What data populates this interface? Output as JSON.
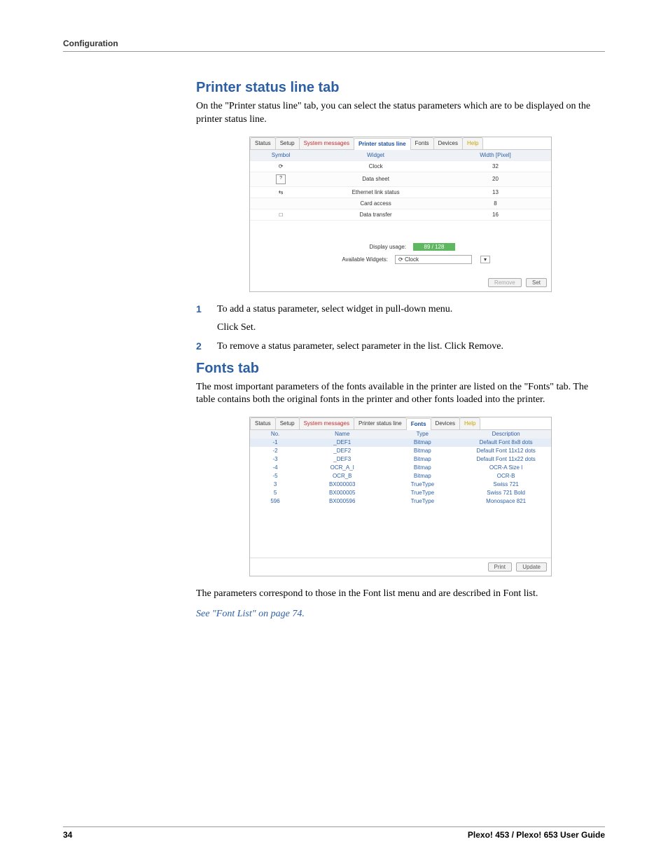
{
  "page": {
    "header": "Configuration",
    "number": "34",
    "guide": "Plexo! 453 / Plexo! 653 User Guide"
  },
  "section1": {
    "title": "Printer status line tab",
    "intro": "On the \"Printer status line\" tab, you can select the status parameters which are to be displayed on the printer status line.",
    "step1_num": "1",
    "step1": "To add a status parameter, select widget in pull-down menu.",
    "step1_sub": "Click Set.",
    "step2_num": "2",
    "step2": "To remove a status parameter, select parameter in the list. Click Remove."
  },
  "section2": {
    "title": "Fonts tab",
    "intro": "The most important parameters of the fonts available in the printer are listed on the \"Fonts\" tab. The table contains both the original fonts in the printer and other fonts loaded into the printer.",
    "after": "The parameters correspond to those in the Font list menu and are described in Font list.",
    "link": "See \"Font List\" on page 74."
  },
  "screenshot_tabs": {
    "status": "Status",
    "setup": "Setup",
    "system_messages": "System messages",
    "printer_status_line": "Printer status line",
    "fonts": "Fonts",
    "devices": "Devices",
    "help": "Help"
  },
  "screenshot1": {
    "hdr": {
      "symbol": "Symbol",
      "widget": "Widget",
      "width": "Width [Pixel]"
    },
    "rows": [
      {
        "symbol": "⟳",
        "widget": "Clock",
        "width": "32"
      },
      {
        "symbol": "?",
        "widget": "Data sheet",
        "width": "20"
      },
      {
        "symbol": "⇆",
        "widget": "Ethernet link status",
        "width": "13"
      },
      {
        "symbol": "",
        "widget": "Card access",
        "width": "8"
      },
      {
        "symbol": "□",
        "widget": "Data transfer",
        "width": "16"
      }
    ],
    "display_usage_label": "Display usage:",
    "display_usage_value": "89 / 128",
    "available_label": "Available Widgets:",
    "available_value": "Clock",
    "remove": "Remove",
    "set": "Set"
  },
  "screenshot2": {
    "hdr": {
      "no": "No.",
      "name": "Name",
      "type": "Type",
      "desc": "Description"
    },
    "rows": [
      {
        "no": "-1",
        "name": "_DEF1",
        "type": "Bitmap",
        "desc": "Default Font 8x8 dots"
      },
      {
        "no": "-2",
        "name": "_DEF2",
        "type": "Bitmap",
        "desc": "Default Font 11x12 dots"
      },
      {
        "no": "-3",
        "name": "_DEF3",
        "type": "Bitmap",
        "desc": "Default Font 11x22 dots"
      },
      {
        "no": "-4",
        "name": "OCR_A_I",
        "type": "Bitmap",
        "desc": "OCR-A Size I"
      },
      {
        "no": "-5",
        "name": "OCR_B",
        "type": "Bitmap",
        "desc": "OCR-B"
      },
      {
        "no": "3",
        "name": "BX000003",
        "type": "TrueType",
        "desc": "Swiss 721"
      },
      {
        "no": "5",
        "name": "BX000005",
        "type": "TrueType",
        "desc": "Swiss 721 Bold"
      },
      {
        "no": "596",
        "name": "BX000596",
        "type": "TrueType",
        "desc": "Monospace 821"
      }
    ],
    "print": "Print",
    "update": "Update"
  }
}
